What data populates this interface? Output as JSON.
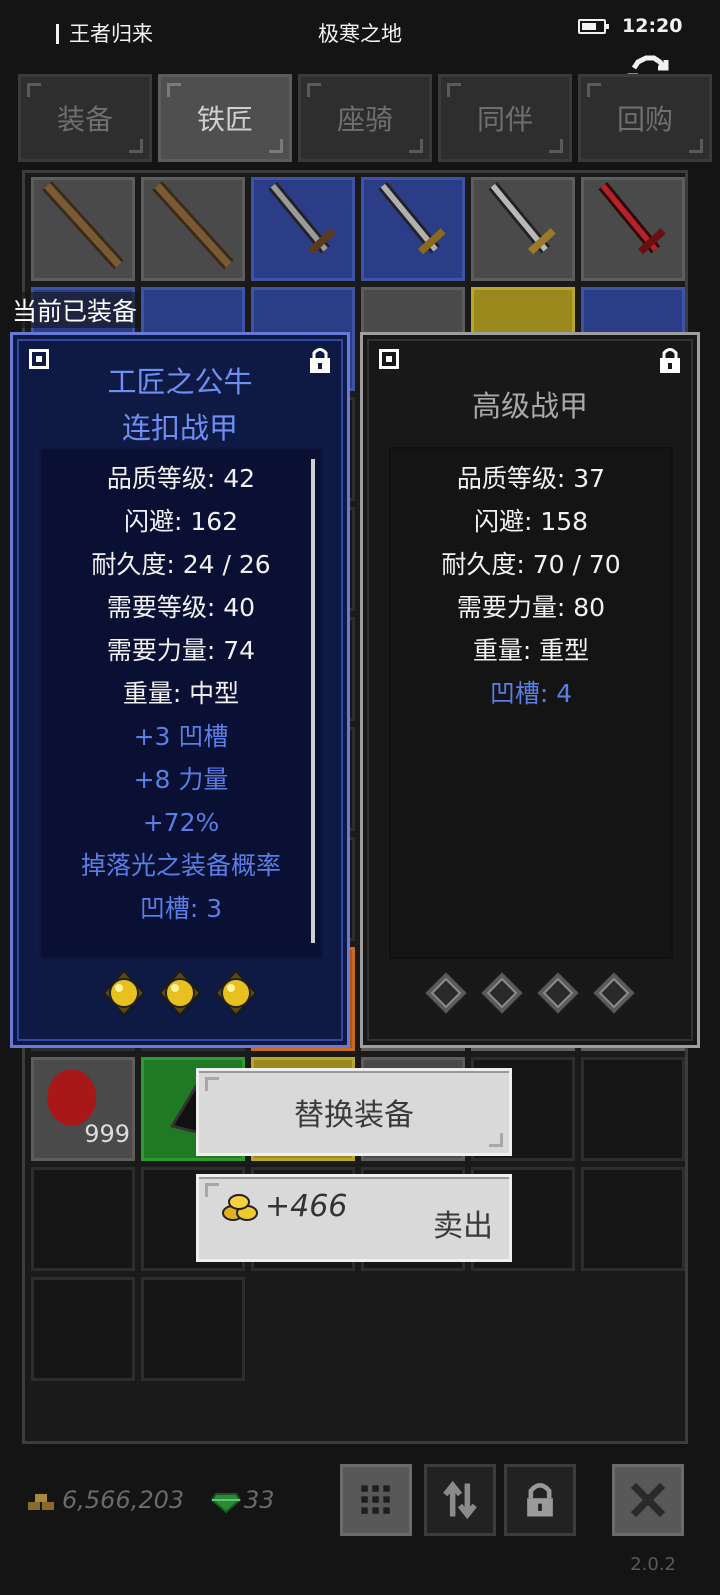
{
  "status_bar": {
    "left_label": "王者归来",
    "center_label": "极寒之地",
    "time": "12:20"
  },
  "tabs": [
    {
      "label": "装备",
      "active": false
    },
    {
      "label": "铁匠",
      "active": true
    },
    {
      "label": "座骑",
      "active": false
    },
    {
      "label": "同伴",
      "active": false
    },
    {
      "label": "回购",
      "active": false
    }
  ],
  "section_title": "当前已装备",
  "equipped_item": {
    "title_line1": "工匠之公牛",
    "title_line2": "连扣战甲",
    "stats": [
      {
        "text": "品质等级: 42",
        "style": "white"
      },
      {
        "text": "闪避: 162",
        "style": "white"
      },
      {
        "text": "耐久度: 24 / 26",
        "style": "white"
      },
      {
        "text": "需要等级: 40",
        "style": "white"
      },
      {
        "text": "需要力量: 74",
        "style": "white"
      },
      {
        "text": "重量: 中型",
        "style": "white"
      },
      {
        "text": "+3 凹槽",
        "style": "blue"
      },
      {
        "text": "+8 力量",
        "style": "blue"
      },
      {
        "text": "+72%",
        "style": "blue"
      },
      {
        "text": "掉落光之装备概率",
        "style": "blue"
      },
      {
        "text": "凹槽: 3",
        "style": "blue"
      }
    ],
    "sockets": [
      "gold-gem",
      "gold-gem",
      "gold-gem"
    ]
  },
  "compare_item": {
    "title": "高级战甲",
    "stats": [
      {
        "text": "品质等级: 37",
        "style": "white"
      },
      {
        "text": "闪避: 158",
        "style": "white"
      },
      {
        "text": "耐久度: 70 / 70",
        "style": "white"
      },
      {
        "text": "需要力量: 80",
        "style": "white"
      },
      {
        "text": "重量: 重型",
        "style": "white"
      },
      {
        "text": "凹槽: 4",
        "style": "blue"
      }
    ],
    "sockets": [
      "empty",
      "empty",
      "empty",
      "empty"
    ]
  },
  "popup": {
    "replace_label": "替换装备",
    "sell_price": "+466",
    "sell_label": "卖出"
  },
  "inventory": {
    "stack_count": "999"
  },
  "footer": {
    "gold_total": "6,566,203",
    "gem_total": "33",
    "version": "2.0.2"
  },
  "colors": {
    "equipped_border": "#6b79d6",
    "equipped_bg": "#0f1a44",
    "blue_stat": "#5a7ee6",
    "compare_border": "#9e9e9e"
  }
}
